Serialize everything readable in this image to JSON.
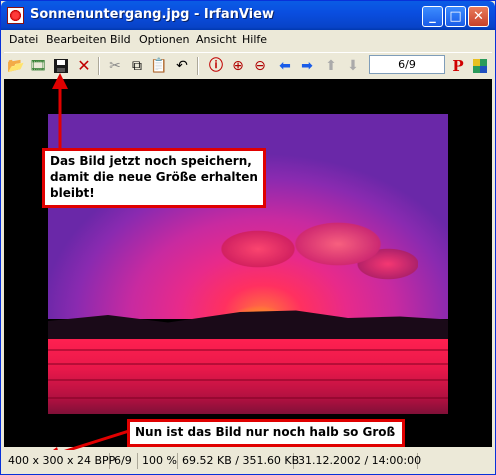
{
  "window": {
    "title": "Sonnenuntergang.jpg - IrfanView",
    "min_label": "_",
    "max_label": "□",
    "close_label": "✕"
  },
  "menu": [
    "Datei",
    "Bearbeiten",
    "Bild",
    "Optionen",
    "Ansicht",
    "Hilfe"
  ],
  "toolbar": {
    "icons": [
      "open-icon",
      "slideshow-icon",
      "save-icon",
      "delete-icon",
      "cut-icon",
      "copy-icon",
      "paste-icon",
      "undo-icon",
      "info-icon",
      "zoom-in-icon",
      "zoom-out-icon",
      "previous-icon",
      "next-icon",
      "up-icon",
      "down-icon",
      "paint-icon",
      "settings-icon"
    ],
    "counter": "6/9"
  },
  "callouts": {
    "save_note": "Das Bild jetzt noch speichern, damit die neue Größe erhalten bleibt!",
    "size_note": "Nun ist das Bild nur noch halb so Groß"
  },
  "status": {
    "dimensions": "400 x 300 x 24 BPP",
    "index": "6/9",
    "zoom": "100 %",
    "filesize": "69.52 KB / 351.60 KB",
    "date": "31.12.2002 / 14:00:00"
  },
  "colors": {
    "accent": "#e00000",
    "titlebar": "#0a4ee0"
  }
}
